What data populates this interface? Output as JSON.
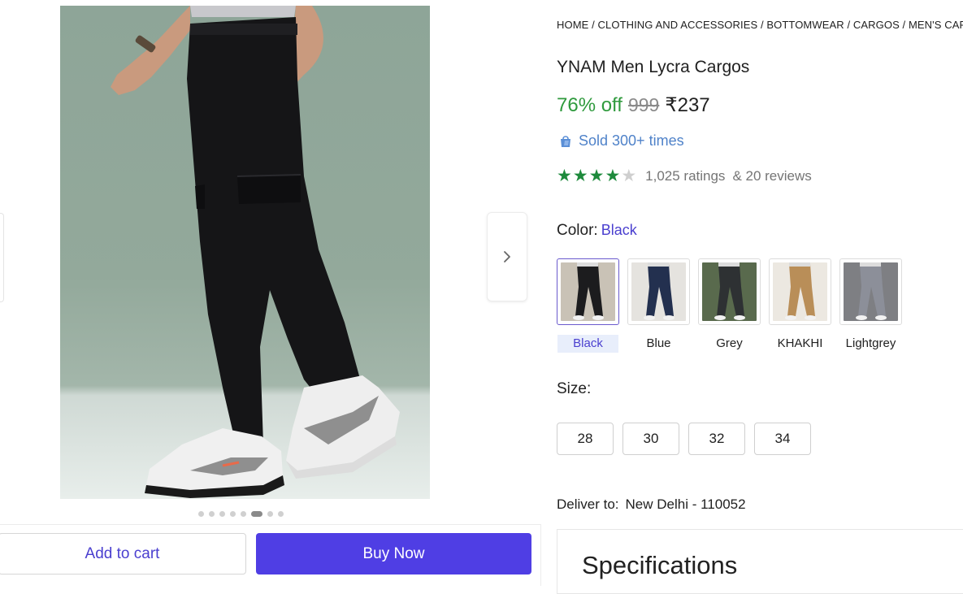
{
  "breadcrumb": "HOME / CLOTHING AND ACCESSORIES / BOTTOMWEAR / CARGOS / MEN'S CARGOS",
  "product": {
    "title": "YNAM Men Lycra Cargos",
    "discount": "76% off",
    "mrp": "999",
    "price": "₹237",
    "sold": "Sold 300+ times",
    "rating": 4,
    "ratings_count": "1,025 ratings",
    "reviews_count": "& 20 reviews"
  },
  "color": {
    "label": "Color:",
    "selected": "Black",
    "options": [
      {
        "label": "Black",
        "fill": "#1c1c1e",
        "bg": "#c9c2b6"
      },
      {
        "label": "Blue",
        "fill": "#23304f",
        "bg": "#e5e3df"
      },
      {
        "label": "Grey",
        "fill": "#2e3133",
        "bg": "#596a4d"
      },
      {
        "label": "KHAKHI",
        "fill": "#b98e58",
        "bg": "#ece8e1"
      },
      {
        "label": "Lightgrey",
        "fill": "#8c8f99",
        "bg": "#7e7f83"
      }
    ]
  },
  "size": {
    "label": "Size:",
    "options": [
      "28",
      "30",
      "32",
      "34"
    ]
  },
  "delivery": {
    "label": "Deliver to:",
    "location": "New Delhi - 110052"
  },
  "specifications_title": "Specifications",
  "actions": {
    "add_to_cart": "Add to cart",
    "buy_now": "Buy Now"
  },
  "gallery": {
    "image_count": 8,
    "active_index": 5
  },
  "colors": {
    "accent": "#4f3ee4",
    "discount_green": "#2f9a3d",
    "star_green": "#1e8a3c",
    "sold_blue": "#4f82c9"
  }
}
